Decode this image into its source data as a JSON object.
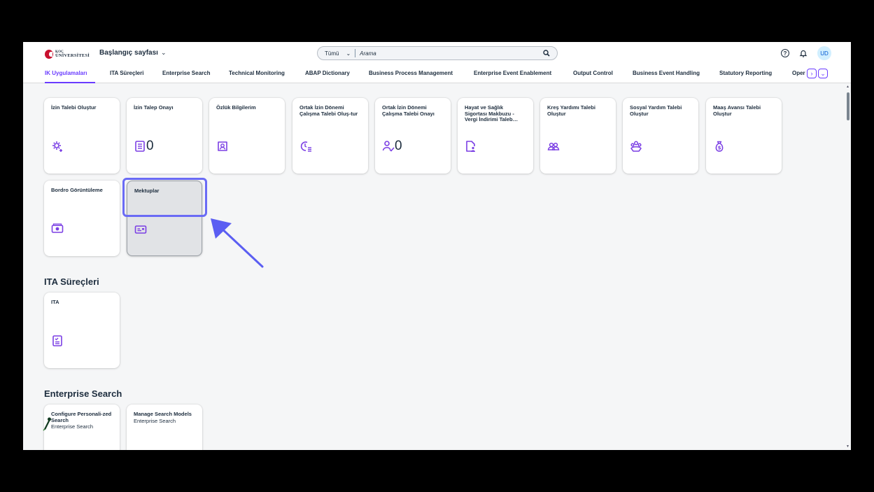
{
  "shell": {
    "logo_line1": "KOÇ",
    "logo_line2": "ÜNİVERSİTESİ",
    "home_title": "Başlangıç sayfası",
    "search_scope": "Tümü",
    "search_placeholder": "Arama",
    "avatar_initials": "UD"
  },
  "tabs": [
    {
      "label": "IK Uygulamaları",
      "active": true
    },
    {
      "label": "ITA Süreçleri"
    },
    {
      "label": "Enterprise Search"
    },
    {
      "label": "Technical Monitoring"
    },
    {
      "label": "ABAP Dictionary"
    },
    {
      "label": "Business Process Management"
    },
    {
      "label": "Enterprise Event Enablement"
    },
    {
      "label": "Output Control"
    },
    {
      "label": "Business Event Handling"
    },
    {
      "label": "Statutory Reporting"
    },
    {
      "label": "Oper"
    }
  ],
  "ik": {
    "tiles": [
      {
        "title": "İzin Talebi Oluştur",
        "icon": "cog-plus-icon"
      },
      {
        "title": "İzin Talep Onayı",
        "icon": "task-list-icon",
        "count": "0"
      },
      {
        "title": "Özlük Bilgilerim",
        "icon": "person-card-icon"
      },
      {
        "title": "Ortak İzin Dönemi Çalışma Talebi Oluş-tur",
        "icon": "clock-list-icon"
      },
      {
        "title": "Ortak İzin Dönemi Çalışma Talebi Onayı",
        "icon": "person-check-icon",
        "count": "0"
      },
      {
        "title": "Hayat ve Sağlık Sigortası Makbuzu - Vergi İndirimi Taleb…",
        "icon": "document-people-icon"
      },
      {
        "title": "Kreş Yardımı Talebi Oluştur",
        "icon": "group-icon"
      },
      {
        "title": "Sosyal Yardım Talebi Oluştur",
        "icon": "family-icon"
      },
      {
        "title": "Maaş Avansı Talebi Oluştur",
        "icon": "money-bag-icon"
      },
      {
        "title": "Bordro Görüntüleme",
        "icon": "payslip-icon"
      },
      {
        "title": "Mektuplar",
        "icon": "letter-card-icon"
      }
    ]
  },
  "ita": {
    "section_title": "ITA Süreçleri",
    "tiles": [
      {
        "title": "ITA",
        "icon": "checklist-icon"
      }
    ]
  },
  "es": {
    "section_title": "Enterprise Search",
    "tiles": [
      {
        "title": "Configure Personali-zed Search",
        "subtitle": "Enterprise Search"
      },
      {
        "title": "Manage Search Models",
        "subtitle": "Enterprise Search"
      }
    ]
  },
  "colors": {
    "accent": "#6a3cff",
    "icon": "#7b3fe4",
    "highlight_box": "#6a6bf5"
  }
}
